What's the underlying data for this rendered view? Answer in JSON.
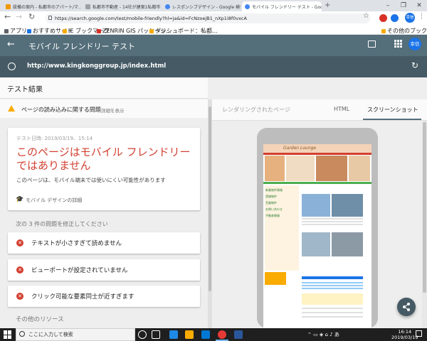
{
  "browser": {
    "tabs": [
      {
        "label": "設備の案内 - 私都市のアパート/マ…",
        "color": "#f29900"
      },
      {
        "label": "私都市不動産 - 14社が建案1私都市…",
        "color": "#5f6368"
      },
      {
        "label": "レスポンシブデザイン - Google 検索",
        "color": "#4285f4"
      },
      {
        "label": "モバイル フレンドリー テスト - Googl…",
        "color": "#4285f4"
      }
    ],
    "active_tab": 3,
    "new_tab": "+",
    "url": "https://search.google.com/test/mobile-friendly?hl=ja&id=FcNzoejB1_nXp1i8f0vxcA",
    "avatar": "幸信",
    "bookmarks": [
      {
        "label": "アプリ",
        "color": "#5f6368"
      },
      {
        "label": "おすすめサイト",
        "color": "#1a73e8"
      },
      {
        "label": "IE ブックマーク",
        "color": "#f9ab00"
      },
      {
        "label": "ZENRIN GIS パッケージ…",
        "color": "#d93025"
      },
      {
        "label": "ダッシュボード：私都…",
        "color": "#f9ab00"
      }
    ],
    "other_bookmarks": "その他のブックマーク"
  },
  "app": {
    "title": "モバイル フレンドリー テスト",
    "avatar": "幸信",
    "tested_url": "http://www.kingkonggroup.jp/index.html"
  },
  "results": {
    "header": "テスト結果",
    "warning": "ページの読み込みに関する問題",
    "warning_link": "詳細を表示",
    "test_date": "テスト日時: 2019/03/19、15:14",
    "verdict": "このページはモバイル フレンドリーではありません",
    "verdict_sub": "このページは、モバイル端末では使いにくい可能性があります",
    "design_link": "モバイル デザインの詳細",
    "issues_heading": "次の 3 件の問題を修正してください",
    "issues": [
      "テキストが小さすぎて読めません",
      "ビューポートが設定されていません",
      "クリック可能な要素同士が近すぎます"
    ],
    "other_resources": "その他のリソース"
  },
  "preview": {
    "rendered_label": "レンダリングされたページ",
    "tabs": [
      "HTML",
      "スクリーンショット"
    ],
    "active_tab": 1,
    "site_logo": "Garden Lounge",
    "site_lines": [
      "新着物件情報",
      "賃貸物件",
      "売買物件",
      "お問い合わせ",
      "不動産情報"
    ]
  },
  "taskbar": {
    "search_placeholder": "ここに入力して検索",
    "time": "16:14",
    "date": "2019/03/19"
  },
  "colors": {
    "appbar": "#546e7a",
    "urlbar": "#455a64",
    "error": "#d23f31",
    "warning": "#f9ab00",
    "accent": "#1a73e8"
  }
}
